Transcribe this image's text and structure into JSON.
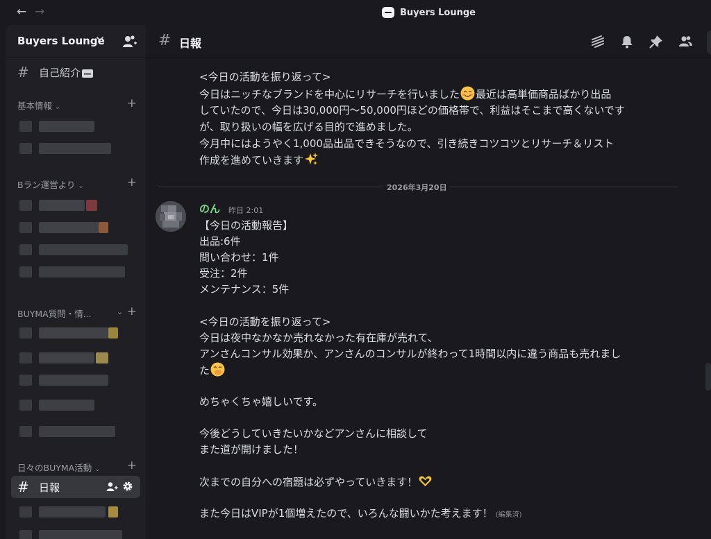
{
  "window": {
    "title": "Buyers Lounge"
  },
  "server": {
    "name": "Buyers Lounge"
  },
  "sidebar": {
    "top_channel": {
      "label": "自己紹介"
    },
    "categories": [
      {
        "label": "基本情報"
      },
      {
        "label": "Bラン運営より"
      },
      {
        "label": "BUYMA質問・情..."
      },
      {
        "label": "日々のBUYMA活動"
      }
    ],
    "active_channel": {
      "label": "日報"
    }
  },
  "channel": {
    "name": "日報"
  },
  "messages": {
    "prev": {
      "lines": [
        "<今日の活動を振り返って>",
        "今日はニッチなブランドを中心にリサーチを行いました",
        "最近は高単価商品ばかり出品",
        "していたので、今日は30,000円〜50,000円ほどの価格帯で、利益はそこまで高くないです",
        "が、取り扱いの幅を広げる目的で進めました。",
        " 今月中にはようやく1,000品出品できそうなので、引き続きコツコツとリサーチ＆リスト",
        "作成を進めていきます"
      ]
    },
    "date_divider": "2026年3月20日",
    "current": {
      "author": "のん",
      "time": "昨日 2:01",
      "edited": "(編集済)",
      "lines": [
        "【今日の活動報告】",
        "出品:6件",
        "問い合わせ：1件",
        "受注：2件",
        "メンテナンス：5件",
        "<今日の活動を振り返って>",
        "今日は夜中なかなか売れなかった有在庫が売れて、",
        "アンさんコンサル効果か、アンさんのコンサルが終わって1時間以内に違う商品も売れまし",
        "た",
        "めちゃくちゃ嬉しいです。",
        "今後どうしていきたいかなどアンさんに相談して",
        "また道が開けました！",
        "次までの自分への宿題は必ずやっていきます！",
        "また今日はVIPが1個増えたので、いろんな闘いかた考えます！"
      ]
    }
  },
  "icons": {
    "back": "←",
    "forward": "→",
    "hash": "#",
    "chevron": "⌄",
    "plus": "+"
  },
  "colors": {
    "author_name": "#7dd88a",
    "active_channel_bg": "#36363d"
  }
}
